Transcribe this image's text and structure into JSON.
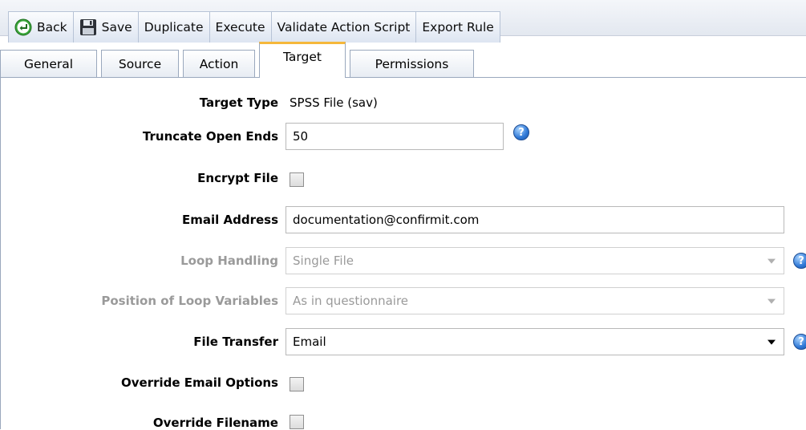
{
  "toolbar": {
    "back_label": "Back",
    "save_label": "Save",
    "duplicate_label": "Duplicate",
    "execute_label": "Execute",
    "validate_label": "Validate Action Script",
    "export_label": "Export Rule"
  },
  "tabs": [
    {
      "label": "General"
    },
    {
      "label": "Source"
    },
    {
      "label": "Action"
    },
    {
      "label": "Target",
      "active": true
    },
    {
      "label": "Permissions"
    }
  ],
  "form": {
    "target_type": {
      "label": "Target Type",
      "value": "SPSS File (sav)"
    },
    "truncate_open_ends": {
      "label": "Truncate Open Ends",
      "value": "50"
    },
    "encrypt_file": {
      "label": "Encrypt File",
      "checked": false
    },
    "email_address": {
      "label": "Email Address",
      "value": "documentation@confirmit.com"
    },
    "loop_handling": {
      "label": "Loop Handling",
      "value": "Single File",
      "disabled": true
    },
    "position_of_loop_variables": {
      "label": "Position of Loop Variables",
      "value": "As in questionnaire",
      "disabled": true
    },
    "file_transfer": {
      "label": "File Transfer",
      "value": "Email"
    },
    "override_email_options": {
      "label": "Override Email Options",
      "checked": false
    },
    "override_filename": {
      "label": "Override Filename",
      "checked": false
    }
  },
  "icons": {
    "back": "back-arrow-circle-icon",
    "save": "floppy-disk-icon",
    "help": "help-question-icon"
  },
  "colors": {
    "active_tab_accent": "#f5b73b",
    "disabled_text": "#9a9a9a",
    "help_blue": "#2f78d6"
  }
}
